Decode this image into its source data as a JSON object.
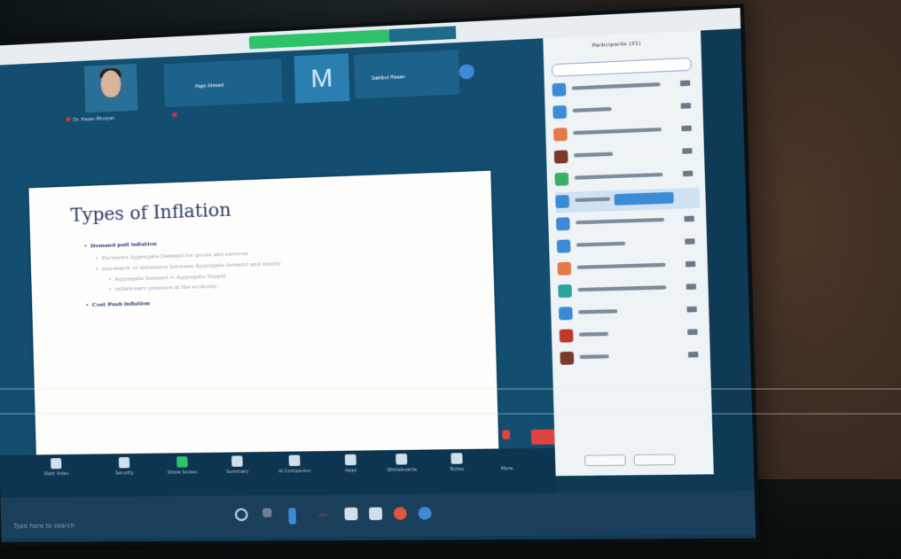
{
  "meeting": {
    "participants_tiles": [
      {
        "name": "Dr. Hasan Bhuiyan"
      },
      {
        "name": "Hajir Ahmed"
      },
      {
        "name": "Sakibul Hasan"
      }
    ],
    "m_avatar_letter": "M"
  },
  "slide": {
    "title": "Types of Inflation",
    "bullets": [
      "Demand pull inflation",
      "Excessive Aggregate Demand for goods and services",
      "mis-match or imbalance between Aggregate demand and supply",
      "Aggregate Demand > Aggregate Supply",
      "inflationary pressure in the economy",
      "Cost Push inflation"
    ]
  },
  "panel": {
    "title": "Participants (31)",
    "rows": 15
  },
  "toolbar": {
    "items": [
      "Start Video",
      "Security",
      "Share Screen",
      "Summary",
      "AI Companion",
      "Apps",
      "Whiteboards",
      "Notes"
    ],
    "more": "More",
    "end": "End"
  },
  "taskbar": {
    "search_placeholder": "Type here to search"
  },
  "colors": {
    "screen_bg": "#134e70",
    "end_button": "#e0443e",
    "banner": "#2ec36a",
    "slide_title": "#2b3a68"
  }
}
